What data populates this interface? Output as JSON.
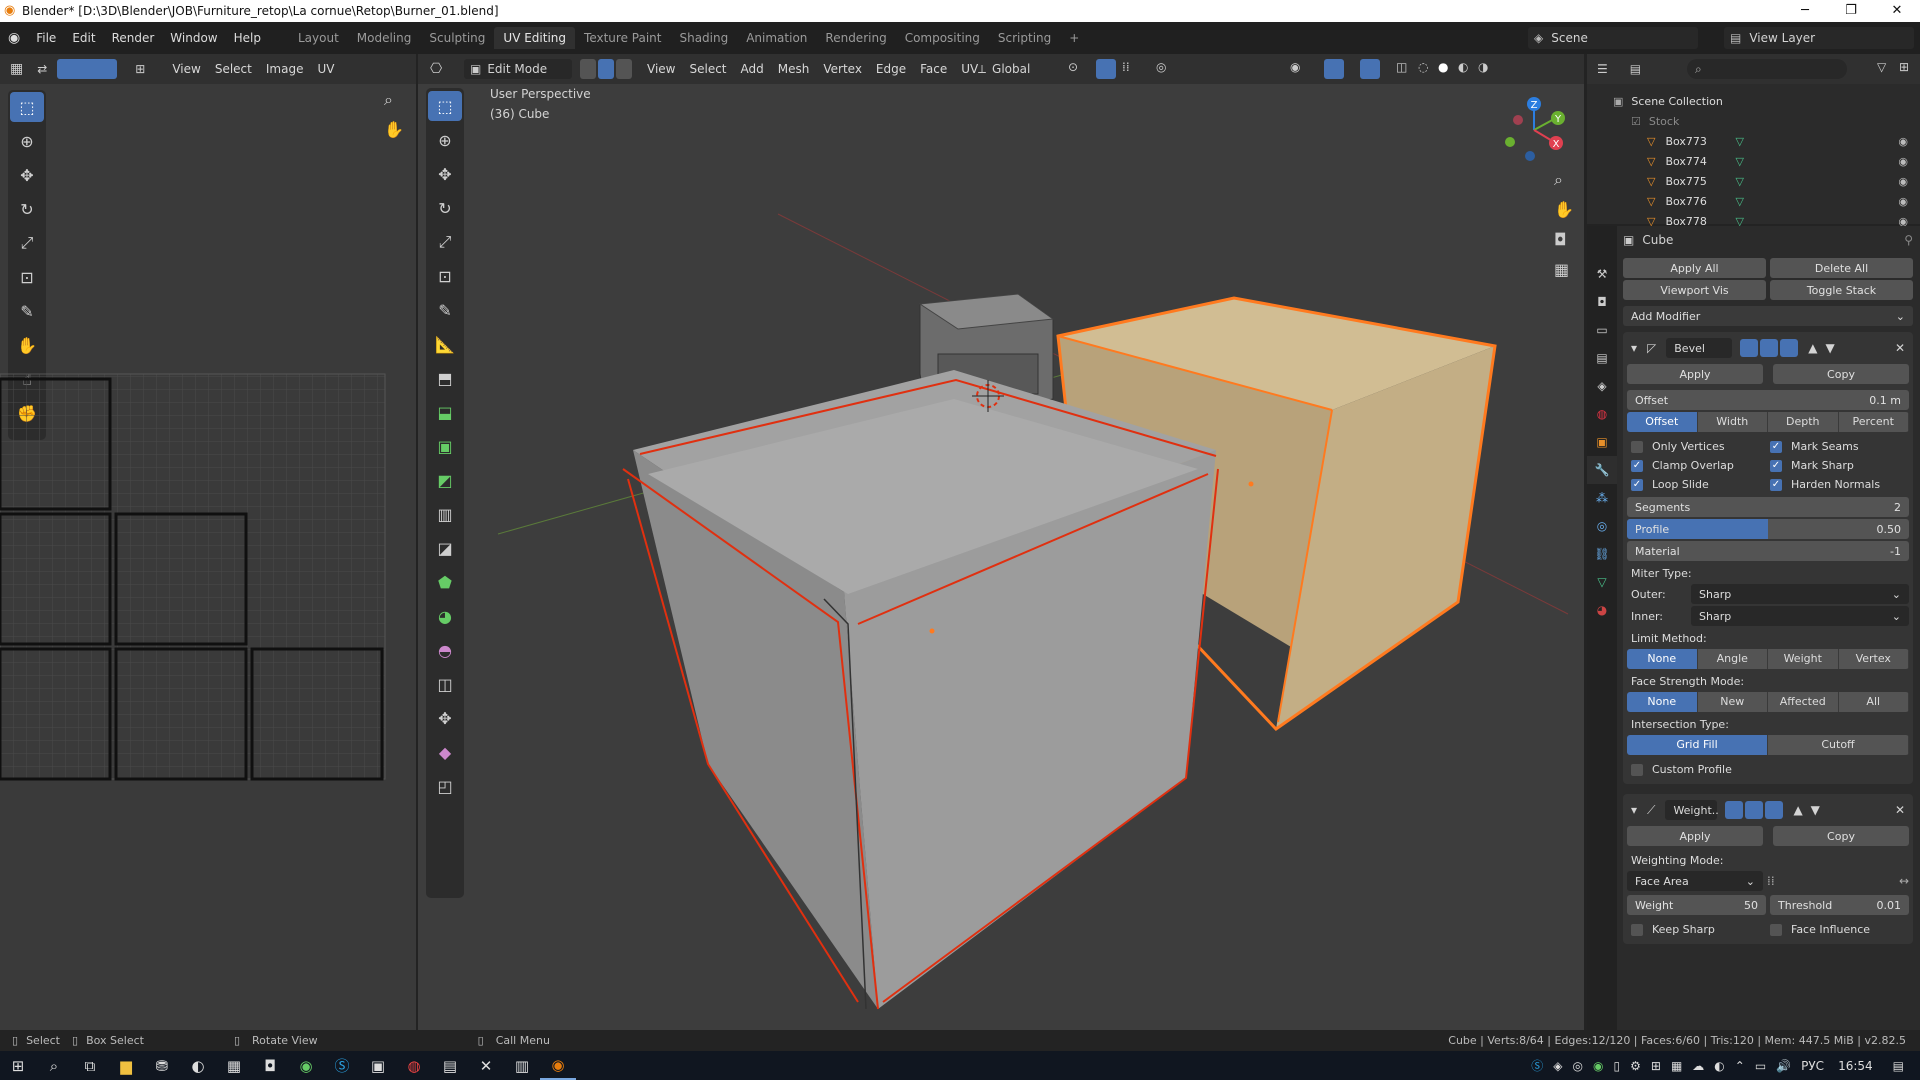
{
  "window": {
    "title": "Blender* [D:\\3D\\Blender\\JOB\\Furniture_retop\\La cornue\\Retop\\Burner_01.blend]",
    "minimize": "─",
    "maximize": "❐",
    "close": "✕"
  },
  "menu": [
    "File",
    "Edit",
    "Render",
    "Window",
    "Help"
  ],
  "workspaces": [
    "Layout",
    "Modeling",
    "Sculpting",
    "UV Editing",
    "Texture Paint",
    "Shading",
    "Animation",
    "Rendering",
    "Compositing",
    "Scripting"
  ],
  "active_workspace": "UV Editing",
  "scene": {
    "label": "Scene",
    "view_layer": "View Layer"
  },
  "uv_editor": {
    "menus": [
      "View",
      "Select",
      "Image",
      "UV"
    ]
  },
  "viewport": {
    "mode": "Edit Mode",
    "menus": [
      "View",
      "Select",
      "Add",
      "Mesh",
      "Vertex",
      "Edge",
      "Face",
      "UV"
    ],
    "transform": "Global",
    "overlay_title": "User Perspective",
    "overlay_object": "(36) Cube",
    "gizmo_axes": {
      "z": "Z",
      "y": "Y",
      "x": "X"
    }
  },
  "outliner": {
    "search_placeholder": "",
    "scene_collection": "Scene Collection",
    "collection": "Stock",
    "items": [
      "Box773",
      "Box774",
      "Box775",
      "Box776",
      "Box778"
    ]
  },
  "properties": {
    "object": "Cube",
    "apply_all": "Apply All",
    "delete_all": "Delete All",
    "viewport_vis": "Viewport Vis",
    "toggle_stack": "Toggle Stack",
    "add_modifier": "Add Modifier",
    "bevel": {
      "name": "Bevel",
      "apply": "Apply",
      "copy": "Copy",
      "offset_label": "Offset",
      "offset_value": "0.1 m",
      "width_types": [
        "Offset",
        "Width",
        "Depth",
        "Percent"
      ],
      "only_vertices": "Only Vertices",
      "mark_seams": "Mark Seams",
      "clamp_overlap": "Clamp Overlap",
      "mark_sharp": "Mark Sharp",
      "loop_slide": "Loop Slide",
      "harden_normals": "Harden Normals",
      "segments_label": "Segments",
      "segments_value": "2",
      "profile_label": "Profile",
      "profile_value": "0.50",
      "profile_fraction": 0.5,
      "material_label": "Material",
      "material_value": "-1",
      "miter_type": "Miter Type:",
      "outer_label": "Outer:",
      "outer_value": "Sharp",
      "inner_label": "Inner:",
      "inner_value": "Sharp",
      "limit_method": "Limit Method:",
      "limit_options": [
        "None",
        "Angle",
        "Weight",
        "Vertex Group"
      ],
      "face_strength": "Face Strength Mode:",
      "face_strength_options": [
        "None",
        "New",
        "Affected",
        "All"
      ],
      "intersection": "Intersection Type:",
      "intersection_options": [
        "Grid Fill",
        "Cutoff"
      ],
      "custom_profile": "Custom Profile"
    },
    "weighted": {
      "name": "Weight..",
      "apply": "Apply",
      "copy": "Copy",
      "mode_label": "Weighting Mode:",
      "mode_value": "Face Area",
      "weight_label": "Weight",
      "weight_value": "50",
      "threshold_label": "Threshold",
      "threshold_value": "0.01",
      "keep_sharp": "Keep Sharp",
      "face_influence": "Face Influence"
    }
  },
  "statusbar": {
    "select": "Select",
    "box_select": "Box Select",
    "rotate_view": "Rotate View",
    "call_menu": "Call Menu",
    "stats": "Cube | Verts:8/64 | Edges:12/120 | Faces:6/60 | Tris:120 | Mem: 447.5 MiB | v2.82.5"
  },
  "taskbar": {
    "lang": "РУС",
    "time": "16:54"
  },
  "colors": {
    "accent": "#4772b3",
    "selection": "#ff7a1f",
    "seam": "#e03010",
    "mesh": "#9a9a9a",
    "stock": "#c8b48a"
  }
}
